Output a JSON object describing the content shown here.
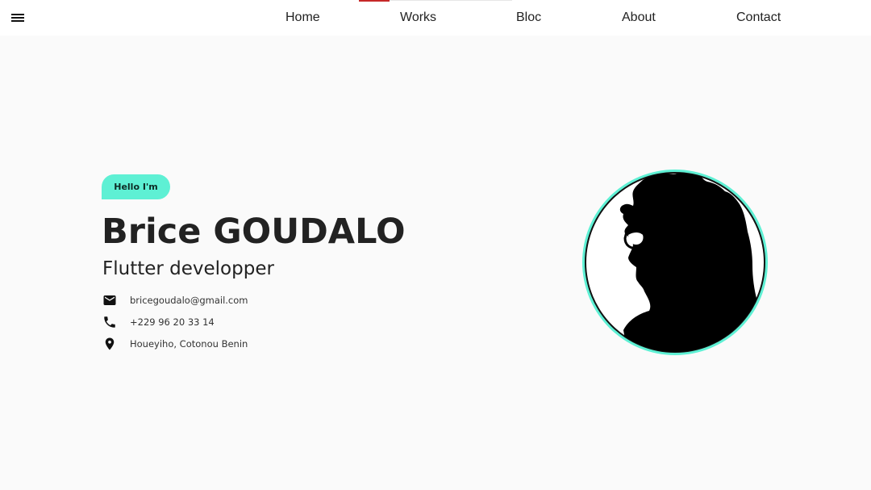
{
  "nav": {
    "items": [
      {
        "label": "Home"
      },
      {
        "label": "Works"
      },
      {
        "label": "Bloc"
      },
      {
        "label": "About"
      },
      {
        "label": "Contact"
      }
    ],
    "indicator_color": "#c62828"
  },
  "hero": {
    "greeting": "Hello I'm",
    "name": "Brice GOUDALO",
    "role": "Flutter developper",
    "accent_color": "#5ef0d4",
    "contacts": [
      {
        "icon": "email-icon",
        "text": "bricegoudalo@gmail.com"
      },
      {
        "icon": "phone-icon",
        "text": "+229 96 20 33 14"
      },
      {
        "icon": "location-pin-icon",
        "text": "Houeyiho, Cotonou Benin"
      }
    ]
  }
}
